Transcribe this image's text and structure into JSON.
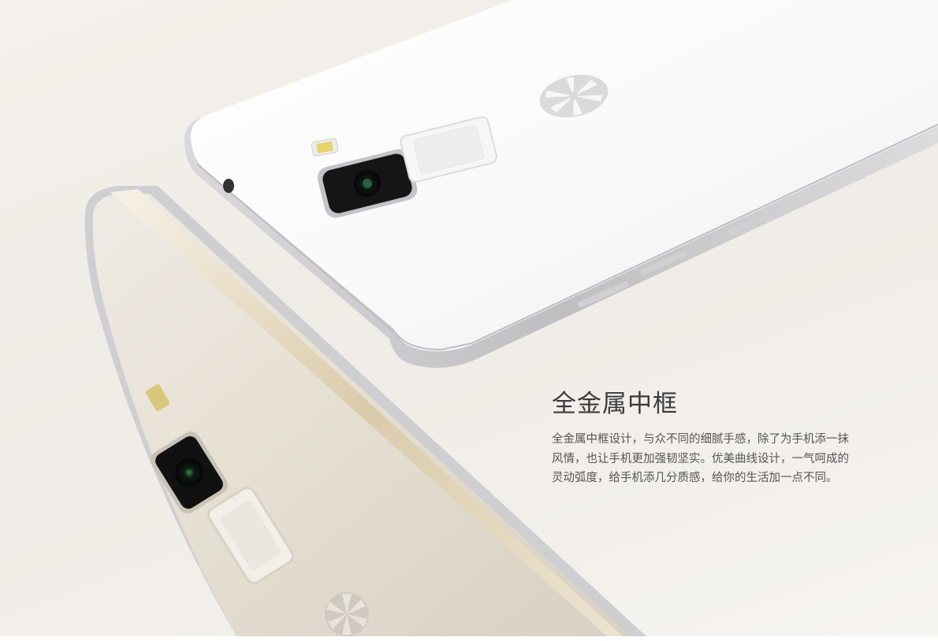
{
  "feature": {
    "headline": "全金属中框",
    "lines": [
      "全金属中框设计，与众不同的细腻手感，除了为手机添一抹",
      "风情，也让手机更加强韧坚实。优美曲线设计，一气呵成的",
      "灵动弧度，给手机添几分质感，给你的生活加一点不同。"
    ]
  },
  "images": {
    "white_phone": "white-phone-back-image",
    "gold_phone": "gold-phone-back-image",
    "brand_logo": "lemon-logo-icon"
  },
  "colors": {
    "background": "#f1eee9",
    "white_phone_body": "#fbfbfb",
    "gold_phone_body": "#e8e2d8",
    "frame_metal": "#c9c9cb",
    "text": "#555555",
    "headline": "#3a3a3a"
  }
}
